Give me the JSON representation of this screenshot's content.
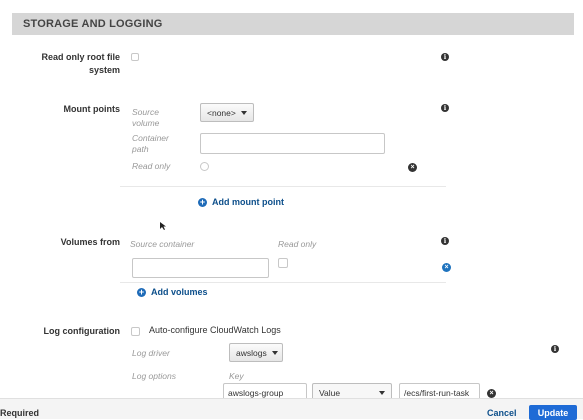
{
  "section": {
    "title": "STORAGE AND LOGGING"
  },
  "read_only_root": {
    "label_line1": "Read only root file",
    "label_line2": "system"
  },
  "mount_points": {
    "label": "Mount points",
    "source_volume_line1": "Source",
    "source_volume_line2": "volume",
    "source_volume_value": "<none>",
    "container_path_line1": "Container",
    "container_path_line2": "path",
    "container_path_value": "",
    "read_only": "Read only",
    "add_label": "Add mount point"
  },
  "volumes_from": {
    "label": "Volumes from",
    "source_container": "Source container",
    "read_only": "Read only",
    "source_container_value": "",
    "add_label": "Add volumes"
  },
  "log_configuration": {
    "label": "Log configuration",
    "autoconfigure_label": "Auto-configure CloudWatch Logs",
    "log_driver_label": "Log driver",
    "log_driver_value": "awslogs",
    "log_options_label": "Log options",
    "key_header": "Key",
    "option_key": "awslogs-group",
    "option_type": "Value",
    "option_value": "/ecs/first-run-task"
  },
  "footer": {
    "required_note": "* Required",
    "cancel_label": "Cancel",
    "update_label": "Update"
  },
  "icons": {
    "info": "info-icon",
    "remove": "remove-icon",
    "add": "plus-circle-icon"
  },
  "colors": {
    "link": "#0d4f8b",
    "primary_button": "#1e6bd6",
    "header_bg": "#d6d6d6"
  }
}
